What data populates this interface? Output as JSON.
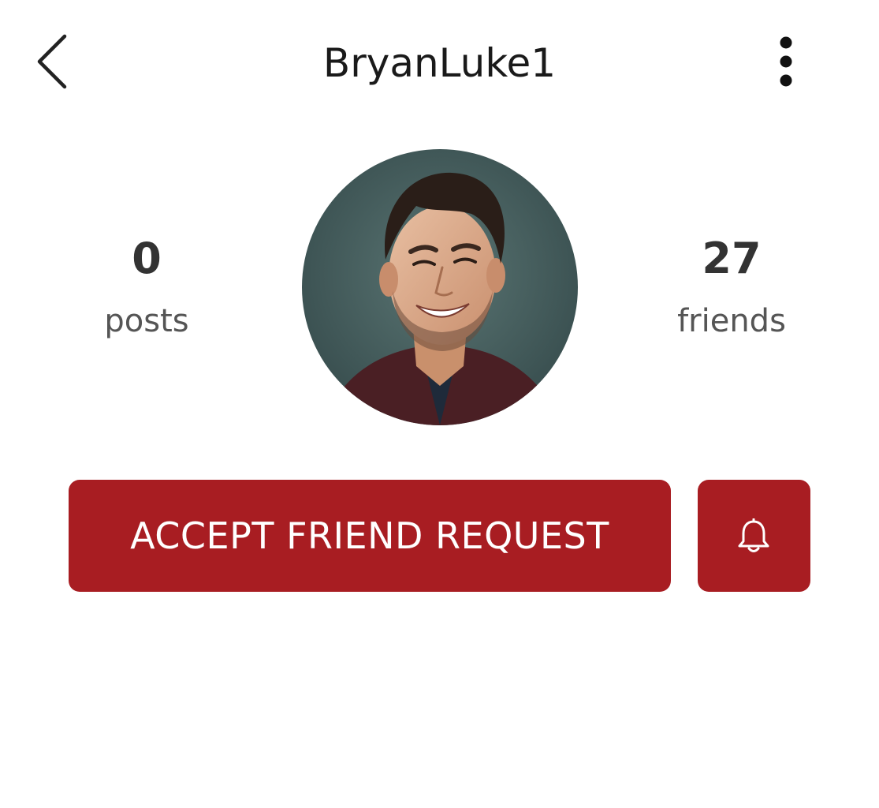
{
  "header": {
    "username": "BryanLuke1",
    "back_icon": "chevron-left-icon",
    "menu_icon": "more-vertical-icon"
  },
  "profile": {
    "posts_count": "0",
    "posts_label": "posts",
    "friends_count": "27",
    "friends_label": "friends",
    "avatar": "profile-photo"
  },
  "actions": {
    "accept_label": "ACCEPT FRIEND REQUEST",
    "notify_icon": "bell-icon"
  },
  "colors": {
    "accent": "#a81d22",
    "background": "#ffffff",
    "text": "#222222"
  }
}
